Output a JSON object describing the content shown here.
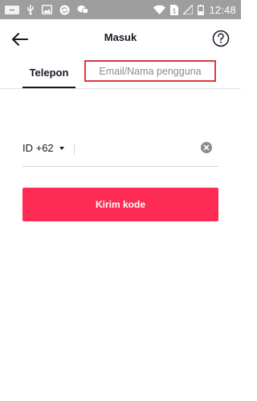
{
  "status_bar": {
    "app_logo": "app-notification-logo",
    "icons": [
      "usb-debug-icon",
      "image-icon",
      "sync-icon",
      "chat-icon",
      "wifi-icon",
      "sim-1-icon",
      "signal-icon",
      "battery-icon"
    ],
    "sim_label": "1",
    "time": "12:48",
    "background": "#9e9e9e"
  },
  "header": {
    "title": "Masuk",
    "back_icon": "arrow-left-icon",
    "help_icon": "question-circle-icon"
  },
  "tabs": {
    "phone_label": "Telepon",
    "email_label": "Email/Nama pengguna",
    "active": "phone",
    "highlight_color": "#d83a3f"
  },
  "phone_form": {
    "country_code": "ID +62",
    "phone_value": "",
    "clear_icon": "clear-circle-icon"
  },
  "send_button": {
    "label": "Kirim kode",
    "color": "#fe2c55"
  }
}
